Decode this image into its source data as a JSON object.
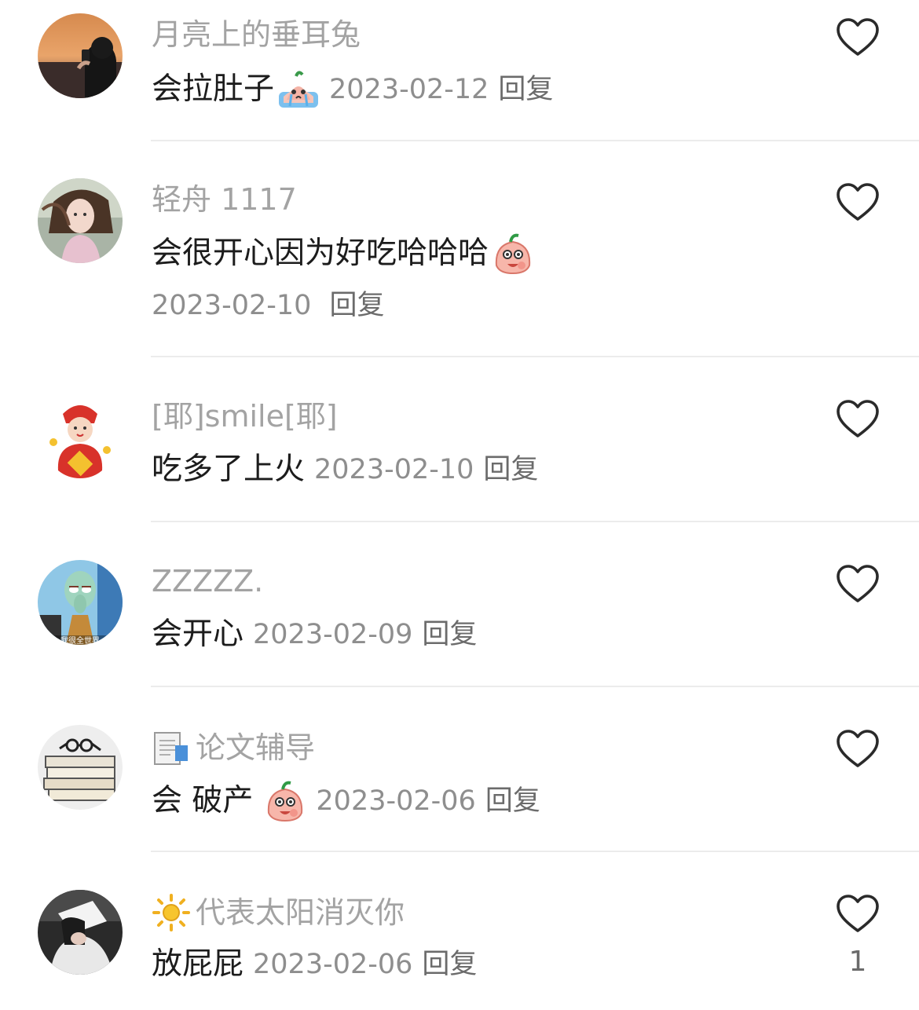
{
  "comments": [
    {
      "username": "月亮上的垂耳兔",
      "text": "会拉肚子",
      "emoji": "crying-peach-emoji",
      "date": "2023-02-12",
      "reply": "回复",
      "avatar": "avatar-sunset-phone",
      "like_icon": "heart-outline-icon"
    },
    {
      "username": "轻舟 1117",
      "text": "会很开心因为好吃哈哈哈",
      "emoji": "peach-laugh-emoji",
      "date": "2023-02-10",
      "reply": "回复",
      "avatar": "avatar-girl-windy",
      "like_icon": "heart-outline-icon"
    },
    {
      "username": "[耶]smile[耶]",
      "text": "吃多了上火",
      "date": "2023-02-10",
      "reply": "回复",
      "avatar": "avatar-fortune-doll",
      "like_icon": "heart-outline-icon"
    },
    {
      "username": "ZZZZZ.",
      "text": "会开心",
      "date": "2023-02-09",
      "reply": "回复",
      "avatar": "avatar-squidward",
      "avatar_caption": "我很全世界",
      "like_icon": "heart-outline-icon"
    },
    {
      "username": "论文辅导",
      "username_icon": "document-icon",
      "text": "会 破产",
      "emoji": "peach-laugh-emoji",
      "date": "2023-02-06",
      "reply": "回复",
      "avatar": "avatar-books-glasses",
      "like_icon": "heart-outline-icon"
    },
    {
      "username": "代表太阳消灭你",
      "username_icon": "sun-icon",
      "text": "放屁屁",
      "date": "2023-02-06",
      "reply": "回复",
      "avatar": "avatar-person-hat",
      "like_icon": "heart-outline-icon",
      "like_count": "1"
    }
  ],
  "colors": {
    "username": "#a3a3a3",
    "text": "#1c1c1c",
    "meta": "#8e8e8e",
    "divider": "#ececec"
  }
}
